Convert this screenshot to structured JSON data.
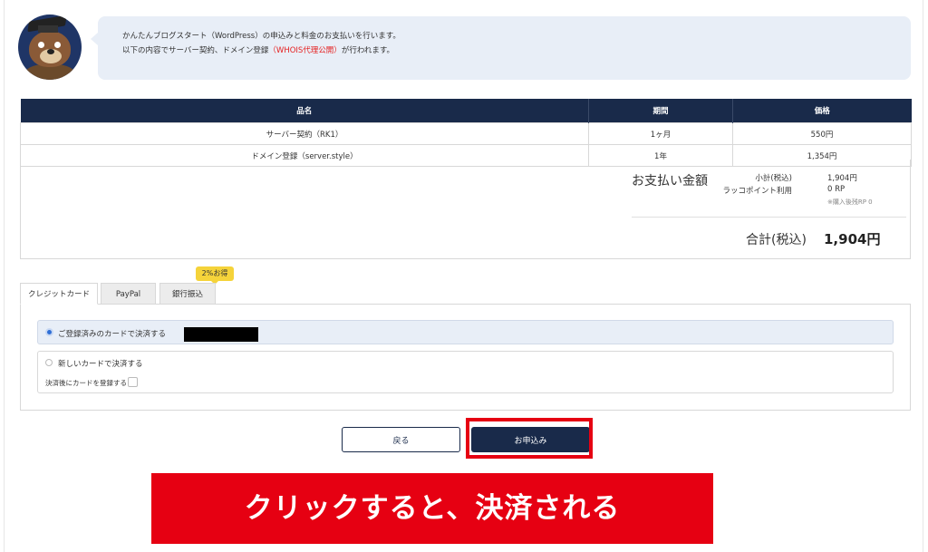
{
  "intro": {
    "line1": "かんたんブログスタート（WordPress）の申込みと料金のお支払いを行います。",
    "line2_before": "以下の内容でサーバー契約、ドメイン登録",
    "line2_highlight": "（WHOIS代理公開）",
    "line2_after": "が行われます。",
    "highlight_color": "#e51f1f"
  },
  "items_table": {
    "headers": [
      "品名",
      "期間",
      "価格"
    ],
    "rows": [
      {
        "name": "サーバー契約（RK1）",
        "period": "1ヶ月",
        "price": "550円"
      },
      {
        "name": "ドメイン登録（server.style）",
        "period": "1年",
        "price": "1,354円"
      }
    ]
  },
  "summary": {
    "title": "お支払い金額",
    "subtotal_label": "小計(税込)",
    "subtotal_value": "1,904円",
    "points_label": "ラッコポイント利用",
    "points_value": "0 RP",
    "points_note": "※購入後残RP 0",
    "total_label": "合計(税込)",
    "total_value": "1,904円"
  },
  "payment": {
    "tabs": [
      "クレジットカード",
      "PayPal",
      "銀行振込"
    ],
    "active_tab": "クレジットカード",
    "bank_badge": "2%お得",
    "options": {
      "registered": "ご登録済みのカードで決済する",
      "new_card": "新しいカードで決済する",
      "save_card": "決済後にカードを登録する"
    }
  },
  "buttons": {
    "back": "戻る",
    "submit": "お申込み"
  },
  "annotation": {
    "text": "クリックすると、決済される",
    "color": "#e60012"
  },
  "colors": {
    "navy": "#192a4a",
    "light_blue_bg": "#e8eef7"
  }
}
